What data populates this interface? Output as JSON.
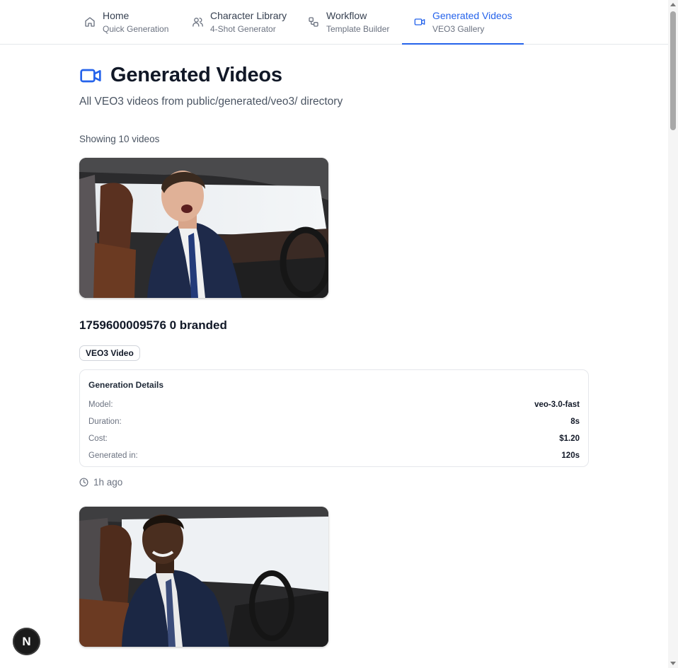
{
  "nav": {
    "tabs": [
      {
        "label": "Home",
        "sub": "Quick Generation",
        "icon": "home-icon"
      },
      {
        "label": "Character Library",
        "sub": "4-Shot Generator",
        "icon": "users-icon"
      },
      {
        "label": "Workflow",
        "sub": "Template Builder",
        "icon": "workflow-icon"
      },
      {
        "label": "Generated Videos",
        "sub": "VEO3 Gallery",
        "icon": "video-icon",
        "active": true
      }
    ],
    "accent_color": "#2563eb"
  },
  "page": {
    "title": "Generated Videos",
    "subtitle": "All VEO3 videos from public/generated/veo3/ directory",
    "count_text": "Showing 10 videos"
  },
  "videos": [
    {
      "title": "1759600009576 0 branded",
      "badge": "VEO3 Video",
      "details": {
        "heading": "Generation Details",
        "rows": [
          {
            "key": "Model:",
            "value": "veo-3.0-fast"
          },
          {
            "key": "Duration:",
            "value": "8s"
          },
          {
            "key": "Cost:",
            "value": "$1.20"
          },
          {
            "key": "Generated in:",
            "value": "120s"
          }
        ]
      },
      "time_ago": "1h ago"
    }
  ],
  "dev_button": {
    "label": "N"
  }
}
